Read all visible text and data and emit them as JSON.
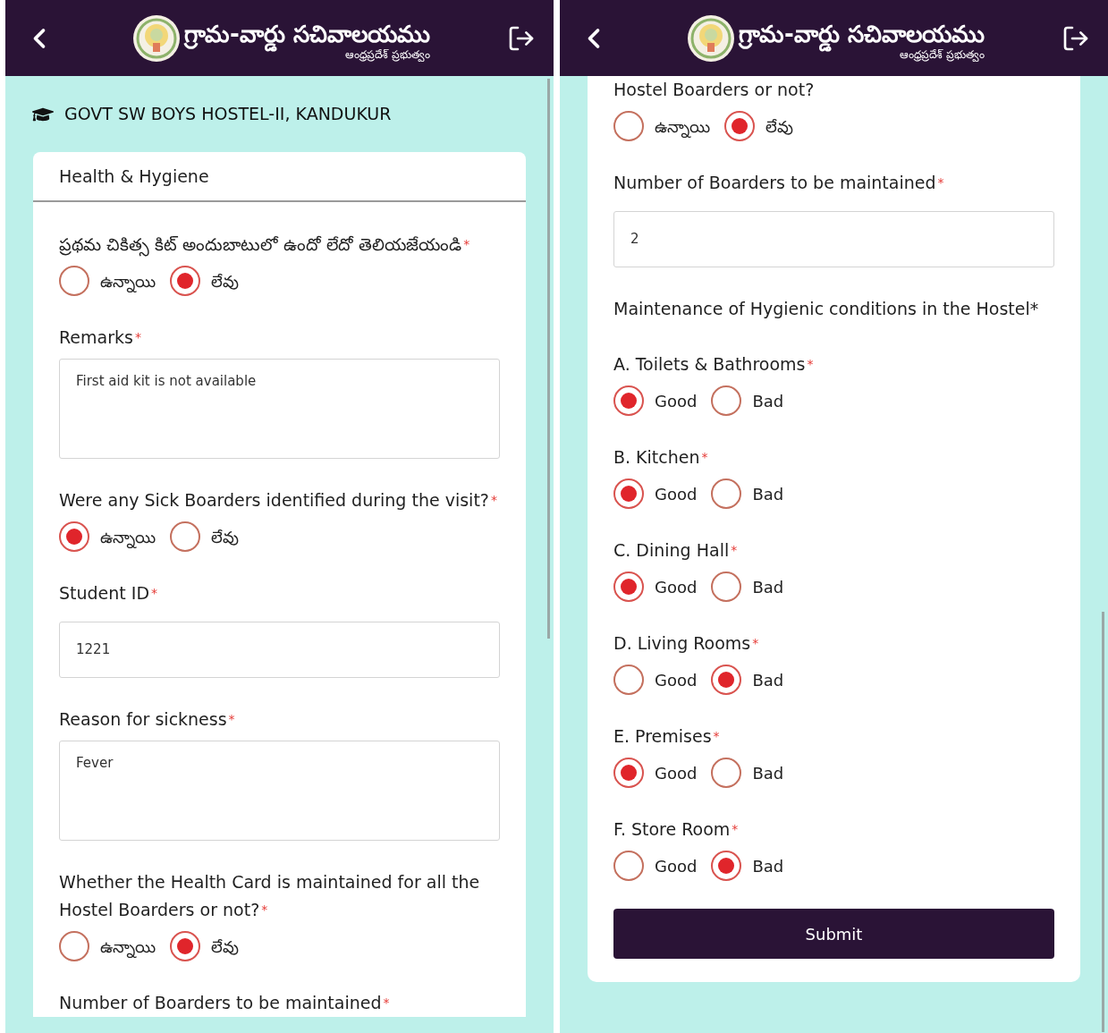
{
  "screens": [
    {
      "header": {
        "title": "గ్రామ-వార్డు సచివాలయము",
        "subtitle": "ఆంధ్రప్రదేశ్ ప్రభుత్వం"
      },
      "hostel": "GOVT SW BOYS HOSTEL-II, KANDUKUR",
      "card_title": "Health & Hygiene",
      "fields": [
        {
          "kind": "radio",
          "label": "ప్రథమ చికిత్స కిట్ అందుబాటులో ఉందో లేదో తెలియజేయండి",
          "mark": "*",
          "options": [
            {
              "label": "ఉన్నాయి",
              "selected": false
            },
            {
              "label": "లేవు",
              "selected": true
            }
          ]
        },
        {
          "kind": "textarea",
          "label": "Remarks",
          "mark": "*",
          "value": "First aid kit is not available"
        },
        {
          "kind": "radio",
          "label": "Were any Sick Boarders identified during the visit?",
          "mark": "*",
          "options": [
            {
              "label": "ఉన్నాయి",
              "selected": true
            },
            {
              "label": "లేవు",
              "selected": false
            }
          ]
        },
        {
          "kind": "input",
          "label": "Student ID",
          "mark": "*",
          "value": "1221"
        },
        {
          "kind": "textarea",
          "label": "Reason for sickness",
          "mark": "*",
          "value": "Fever"
        },
        {
          "kind": "radio",
          "label": "Whether the Health Card is maintained for all the Hostel Boarders or not?",
          "mark": "*",
          "options": [
            {
              "label": "ఉన్నాయి",
              "selected": false
            },
            {
              "label": "లేవు",
              "selected": true
            }
          ]
        },
        {
          "kind": "label",
          "label": "Number of Boarders to be maintained",
          "mark": "*"
        }
      ]
    },
    {
      "header": {
        "title": "గ్రామ-వార్డు సచివాలయము",
        "subtitle": "ఆంధ్రప్రదేశ్ ప్రభుత్వం"
      },
      "fields": [
        {
          "kind": "radio",
          "label": "Hostel Boarders or not?",
          "options": [
            {
              "label": "ఉన్నాయి",
              "selected": false
            },
            {
              "label": "లేవు",
              "selected": true
            }
          ]
        },
        {
          "kind": "input",
          "label": "Number of Boarders to be maintained",
          "mark": "*",
          "value": "2"
        },
        {
          "kind": "heading",
          "label": "Maintenance of Hygienic conditions in the Hostel*"
        },
        {
          "kind": "radio",
          "label": "A. Toilets & Bathrooms",
          "mark": "*",
          "options": [
            {
              "label": "Good",
              "selected": true
            },
            {
              "label": "Bad",
              "selected": false
            }
          ]
        },
        {
          "kind": "radio",
          "label": "B. Kitchen",
          "mark": "*",
          "options": [
            {
              "label": "Good",
              "selected": true
            },
            {
              "label": "Bad",
              "selected": false
            }
          ]
        },
        {
          "kind": "radio",
          "label": "C. Dining Hall",
          "mark": "*",
          "options": [
            {
              "label": "Good",
              "selected": true
            },
            {
              "label": "Bad",
              "selected": false
            }
          ]
        },
        {
          "kind": "radio",
          "label": "D. Living Rooms",
          "mark": "*",
          "options": [
            {
              "label": "Good",
              "selected": false
            },
            {
              "label": "Bad",
              "selected": true
            }
          ]
        },
        {
          "kind": "radio",
          "label": "E. Premises",
          "mark": "*",
          "options": [
            {
              "label": "Good",
              "selected": true
            },
            {
              "label": "Bad",
              "selected": false
            }
          ]
        },
        {
          "kind": "radio",
          "label": "F. Store Room",
          "mark": "*",
          "options": [
            {
              "label": "Good",
              "selected": false
            },
            {
              "label": "Bad",
              "selected": true
            }
          ]
        }
      ],
      "submit": "Submit"
    }
  ]
}
